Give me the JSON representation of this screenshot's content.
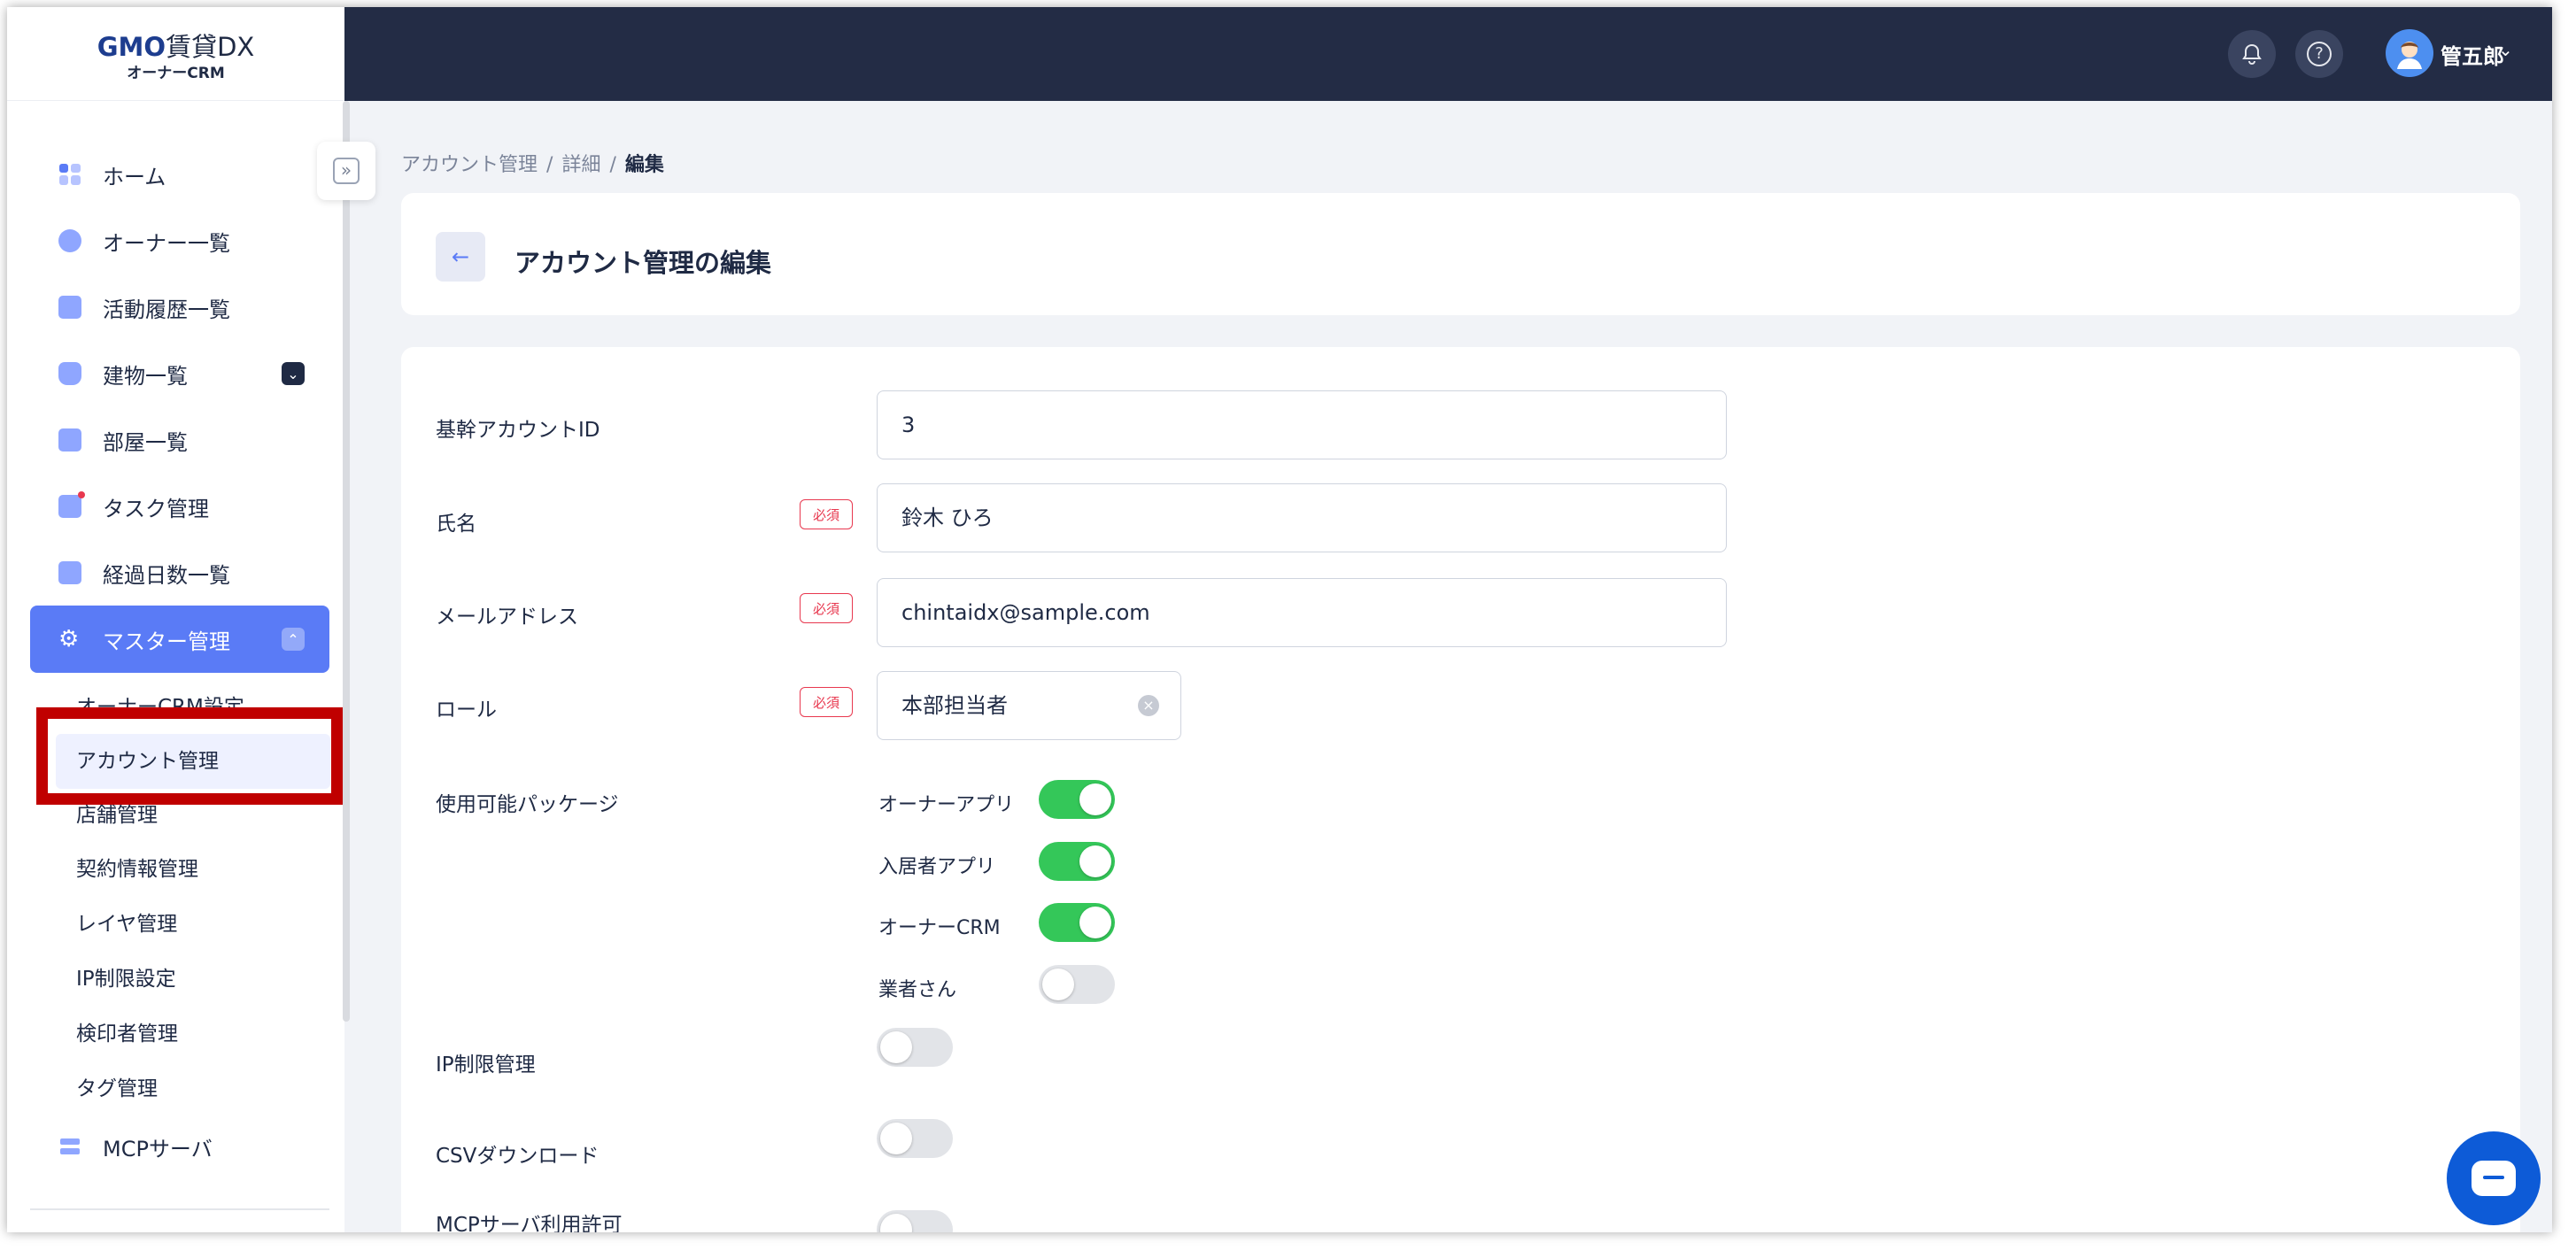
{
  "logo": {
    "brand": "GMO",
    "product": "賃貸DX",
    "sub": "オーナーCRM"
  },
  "topbar": {
    "bell_icon": "bell-icon",
    "help_icon": "help-icon",
    "help_glyph": "?",
    "user_name": "管五郎",
    "user_chevron": "⌄"
  },
  "sidebar": {
    "items": [
      {
        "label": "ホーム",
        "icon": "home-icon"
      },
      {
        "label": "オーナー一覧",
        "icon": "owner-icon"
      },
      {
        "label": "活動履歴一覧",
        "icon": "history-icon"
      },
      {
        "label": "建物一覧",
        "icon": "building-icon",
        "chevron": "⌄"
      },
      {
        "label": "部屋一覧",
        "icon": "room-icon"
      },
      {
        "label": "タスク管理",
        "icon": "task-icon"
      },
      {
        "label": "経過日数一覧",
        "icon": "elapsed-icon"
      },
      {
        "label": "マスター管理",
        "icon": "gear-icon",
        "chevron": "⌃",
        "glyph": "⚙"
      },
      {
        "label": "MCPサーバ",
        "icon": "server-icon"
      }
    ],
    "sub_items": [
      "オーナーCRM設定",
      "アカウント管理",
      "店舗管理",
      "契約情報管理",
      "レイヤ管理",
      "IP制限設定",
      "検印者管理",
      "タグ管理"
    ],
    "collapse_glyph": "»"
  },
  "breadcrumb": {
    "items": [
      "アカウント管理",
      "詳細"
    ],
    "current": "編集",
    "sep": "/"
  },
  "page": {
    "title": "アカウント管理の編集",
    "back_glyph": "←"
  },
  "form": {
    "required_label": "必須",
    "clear_glyph": "×",
    "fields": [
      {
        "label": "基幹アカウントID",
        "value": "3",
        "required": false
      },
      {
        "label": "氏名",
        "value": "鈴木 ひろ",
        "required": true
      },
      {
        "label": "メールアドレス",
        "value": "chintaidx@sample.com",
        "required": true
      },
      {
        "label": "ロール",
        "value": "本部担当者",
        "required": true
      }
    ],
    "packages_label": "使用可能パッケージ",
    "packages": [
      {
        "label": "オーナーアプリ",
        "on": true
      },
      {
        "label": "入居者アプリ",
        "on": true
      },
      {
        "label": "オーナーCRM",
        "on": true
      },
      {
        "label": "業者さん",
        "on": false
      }
    ],
    "ip_label": "IP制限管理",
    "ip_on": false,
    "csv_label": "CSVダウンロード",
    "csv_on": false,
    "mcp_label": "MCPサーバ利用許可",
    "mcp_on": false
  },
  "colors": {
    "accent": "#5a7bf6",
    "topbar": "#232c45",
    "toggle_on": "#34c759",
    "required": "#e8384f",
    "highlight": "#c00000"
  }
}
